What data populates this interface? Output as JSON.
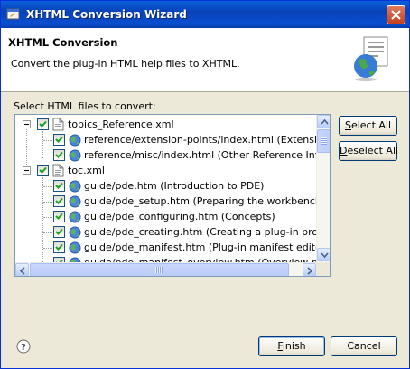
{
  "window": {
    "title": "XHTML Conversion Wizard"
  },
  "banner": {
    "title": "XHTML Conversion",
    "description": "Convert the plug-in HTML help files to XHTML."
  },
  "section": {
    "label": "Select HTML files to convert:"
  },
  "tree": [
    {
      "kind": "group",
      "label": "topics_Reference.xml",
      "checked": true,
      "expanded": true
    },
    {
      "kind": "file",
      "label": "reference/extension-points/index.html (Extension Poi",
      "checked": true
    },
    {
      "kind": "file",
      "label": "reference/misc/index.html (Other Reference Informat",
      "checked": true
    },
    {
      "kind": "group",
      "label": "toc.xml",
      "checked": true,
      "expanded": true
    },
    {
      "kind": "file",
      "label": "guide/pde.htm (Introduction to PDE)",
      "checked": true
    },
    {
      "kind": "file",
      "label": "guide/pde_setup.htm (Preparing the workbench)",
      "checked": true
    },
    {
      "kind": "file",
      "label": "guide/pde_configuring.htm (Concepts)",
      "checked": true
    },
    {
      "kind": "file",
      "label": "guide/pde_creating.htm (Creating a plug-in project)",
      "checked": true
    },
    {
      "kind": "file",
      "label": "guide/pde_manifest.htm (Plug-in manifest editor)",
      "checked": true
    },
    {
      "kind": "file",
      "label": "guide/pde_manifest_overview.htm (Overview page)",
      "checked": true
    }
  ],
  "buttons": {
    "select_all": {
      "mnemonic": "S",
      "rest": "elect All"
    },
    "deselect_all": {
      "mnemonic": "D",
      "rest": "eselect All"
    },
    "finish": {
      "mnemonic": "F",
      "rest": "inish"
    },
    "cancel": "Cancel"
  },
  "icons": {
    "title": "wizard-icon",
    "close": "close-icon",
    "banner": "xhtml-globe-document-icon",
    "help": "help-icon"
  },
  "colors": {
    "titlebar": "#0a5fd8",
    "accent": "#003c74",
    "dialog_bg": "#ece9d8"
  }
}
